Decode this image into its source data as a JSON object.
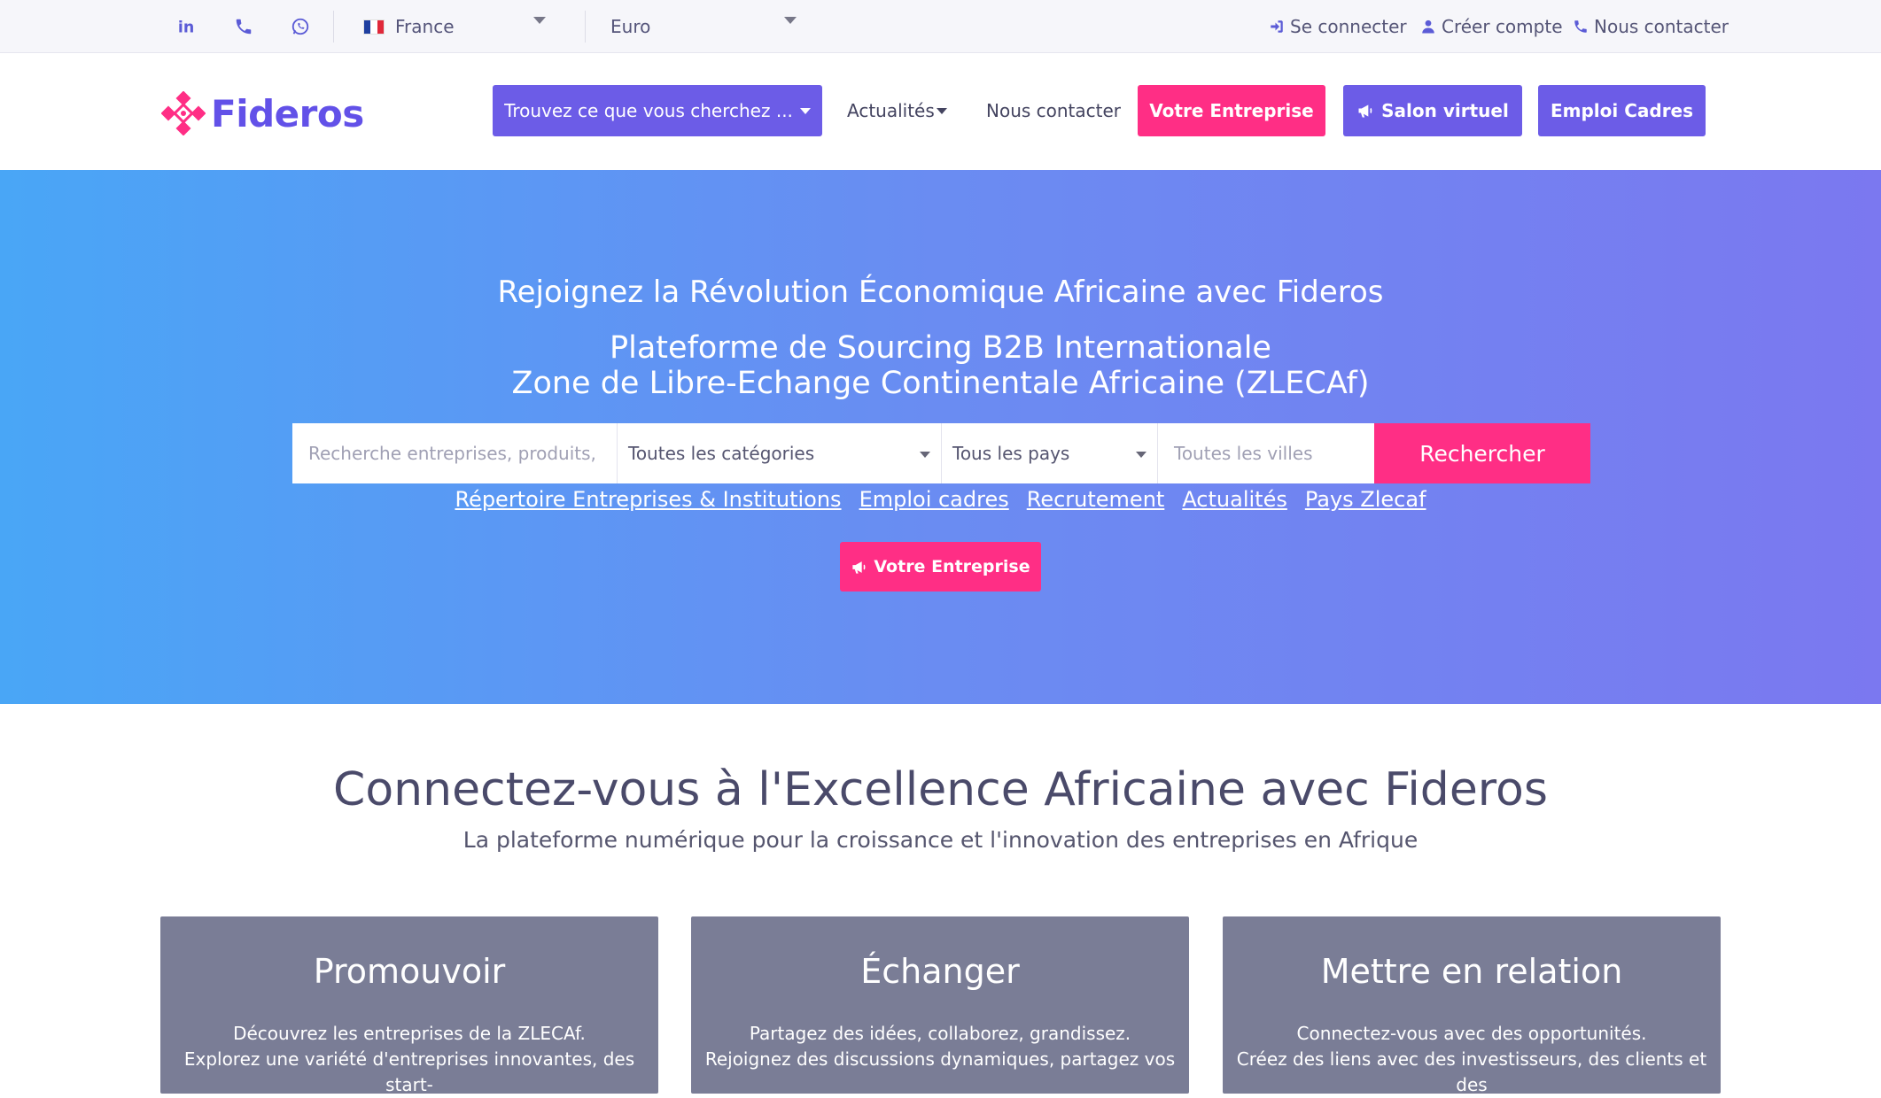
{
  "topbar": {
    "social": [
      "linkedin-icon",
      "phone-icon",
      "whatsapp-icon"
    ],
    "country": "France",
    "currency": "Euro",
    "links": {
      "login": "Se connecter",
      "register": "Créer compte",
      "contact": "Nous contacter"
    }
  },
  "nav": {
    "logo_text": "Fideros",
    "find_button": "Trouvez ce que vous cherchez ...",
    "news": "Actualités",
    "contact": "Nous contacter",
    "company_button": "Votre Entreprise",
    "salon_button": "Salon virtuel",
    "jobs_button": "Emploi Cadres"
  },
  "hero": {
    "title": "Rejoignez la Révolution Économique Africaine avec Fideros",
    "subtitle_line1": "Plateforme de Sourcing B2B Internationale",
    "subtitle_line2": "Zone de Libre-Echange Continentale Africaine (ZLECAf)",
    "search": {
      "placeholder": "Recherche entreprises, produits,",
      "category": "Toutes les catégories",
      "country": "Tous les pays",
      "city_placeholder": "Toutes les villes",
      "button": "Rechercher"
    },
    "links": [
      "Répertoire Entreprises & Institutions",
      "Emploi cadres",
      "Recrutement",
      "Actualités",
      "Pays Zlecaf"
    ],
    "cta": "Votre Entreprise"
  },
  "section": {
    "title": "Connectez-vous à l'Excellence Africaine avec Fideros",
    "subtitle": "La plateforme numérique pour la croissance et l'innovation des entreprises en Afrique",
    "cards": [
      {
        "title": "Promouvoir",
        "line1": "Découvrez les entreprises de la ZLECAf.",
        "line2": "Explorez une variété d'entreprises innovantes, des start-"
      },
      {
        "title": "Échanger",
        "line1": "Partagez des idées, collaborez, grandissez.",
        "line2": "Rejoignez des discussions dynamiques, partagez vos"
      },
      {
        "title": "Mettre en relation",
        "line1": "Connectez-vous avec des opportunités.",
        "line2": "Créez des liens avec des investisseurs, des clients et des"
      }
    ]
  },
  "colors": {
    "brand": "#6251e8",
    "button_primary": "#6c5ce7",
    "accent_pink": "#ff2e85",
    "hero_gradient_start": "#49a6f6",
    "hero_gradient_end": "#7b78f0",
    "card_bg": "#7a7d96"
  }
}
